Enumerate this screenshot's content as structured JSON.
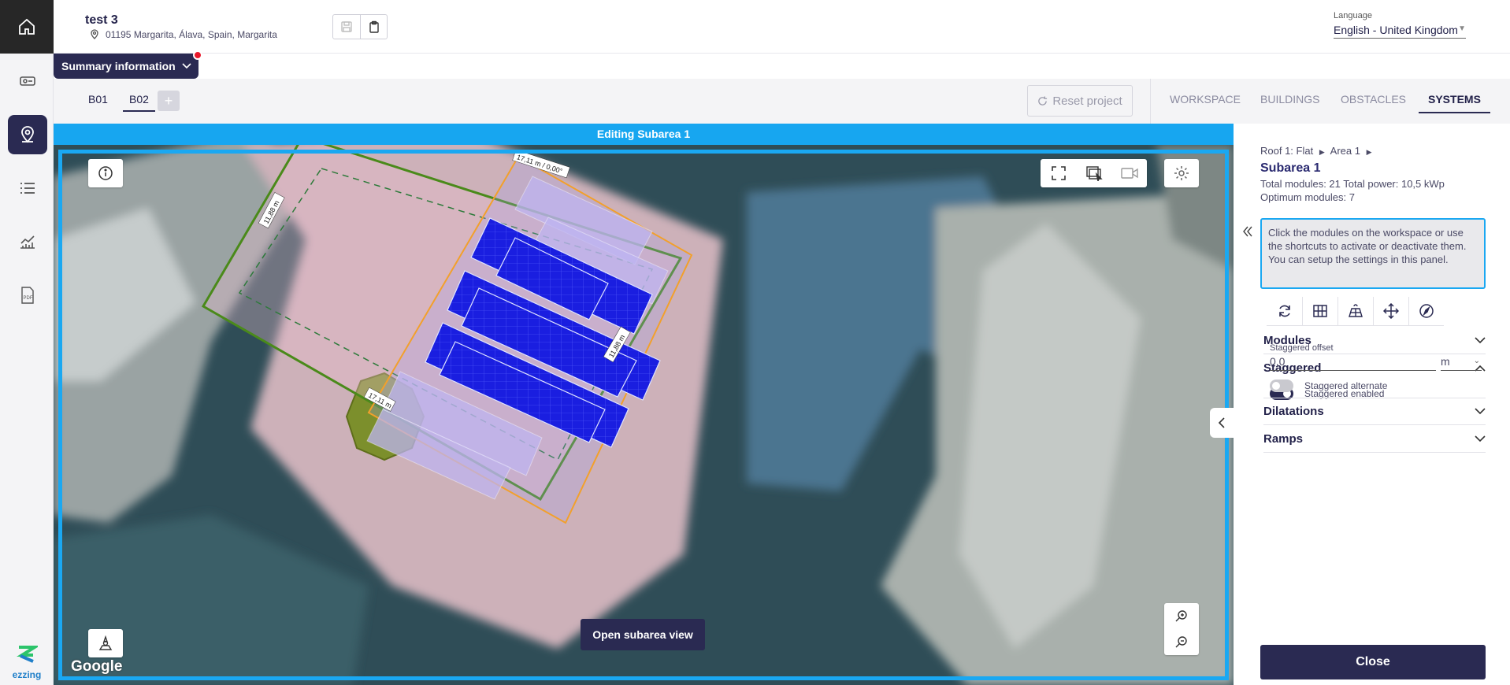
{
  "project": {
    "title": "test 3",
    "address": "01195 Margarita, Álava, Spain, Margarita"
  },
  "language": {
    "label": "Language",
    "value": "English - United Kingdom"
  },
  "summary": {
    "label": "Summary information"
  },
  "buildings": {
    "tabs": [
      "B01",
      "B02"
    ],
    "active": "B02",
    "add": "+"
  },
  "toolbar": {
    "reset_label": "Reset project"
  },
  "nav_tabs": [
    {
      "label": "WORKSPACE",
      "active": false
    },
    {
      "label": "BUILDINGS",
      "active": false
    },
    {
      "label": "OBSTACLES",
      "active": false
    },
    {
      "label": "SYSTEMS",
      "active": true
    }
  ],
  "map": {
    "banner": "Editing Subarea 1",
    "open_subarea_label": "Open subarea view",
    "google_label": "Google",
    "dim_top": "17,11 m / 0,00°",
    "dim_left": "11,88 m",
    "dim_bottom": "17,11 m",
    "dim_right": "11,88 m"
  },
  "panel": {
    "breadcrumb": [
      "Roof 1: Flat",
      "Area 1"
    ],
    "subarea_title": "Subarea 1",
    "total_line": "Total modules: 21 Total power: 10,5 kWp",
    "optimum_line": "Optimum modules: 7",
    "info_text": "Click the modules on the workspace or use the shortcuts to activate or deactivate them. You can setup the settings in this panel.",
    "sections": {
      "modules": "Modules",
      "staggered": "Staggered",
      "dilatations": "Dilatations",
      "ramps": "Ramps"
    },
    "staggered_enabled_label": "Staggered enabled",
    "staggered_enabled": true,
    "staggered_offset_label": "Staggered offset",
    "staggered_offset_value": "0,0",
    "staggered_offset_unit": "m",
    "staggered_alternate_label": "Staggered alternate",
    "staggered_alternate": false,
    "close_label": "Close"
  },
  "brand": {
    "name": "ezzing"
  },
  "colors": {
    "navy": "#2a2a52",
    "accent": "#1aa8f2",
    "alert": "#e8172a",
    "module_blue": "#1a1ee0"
  }
}
